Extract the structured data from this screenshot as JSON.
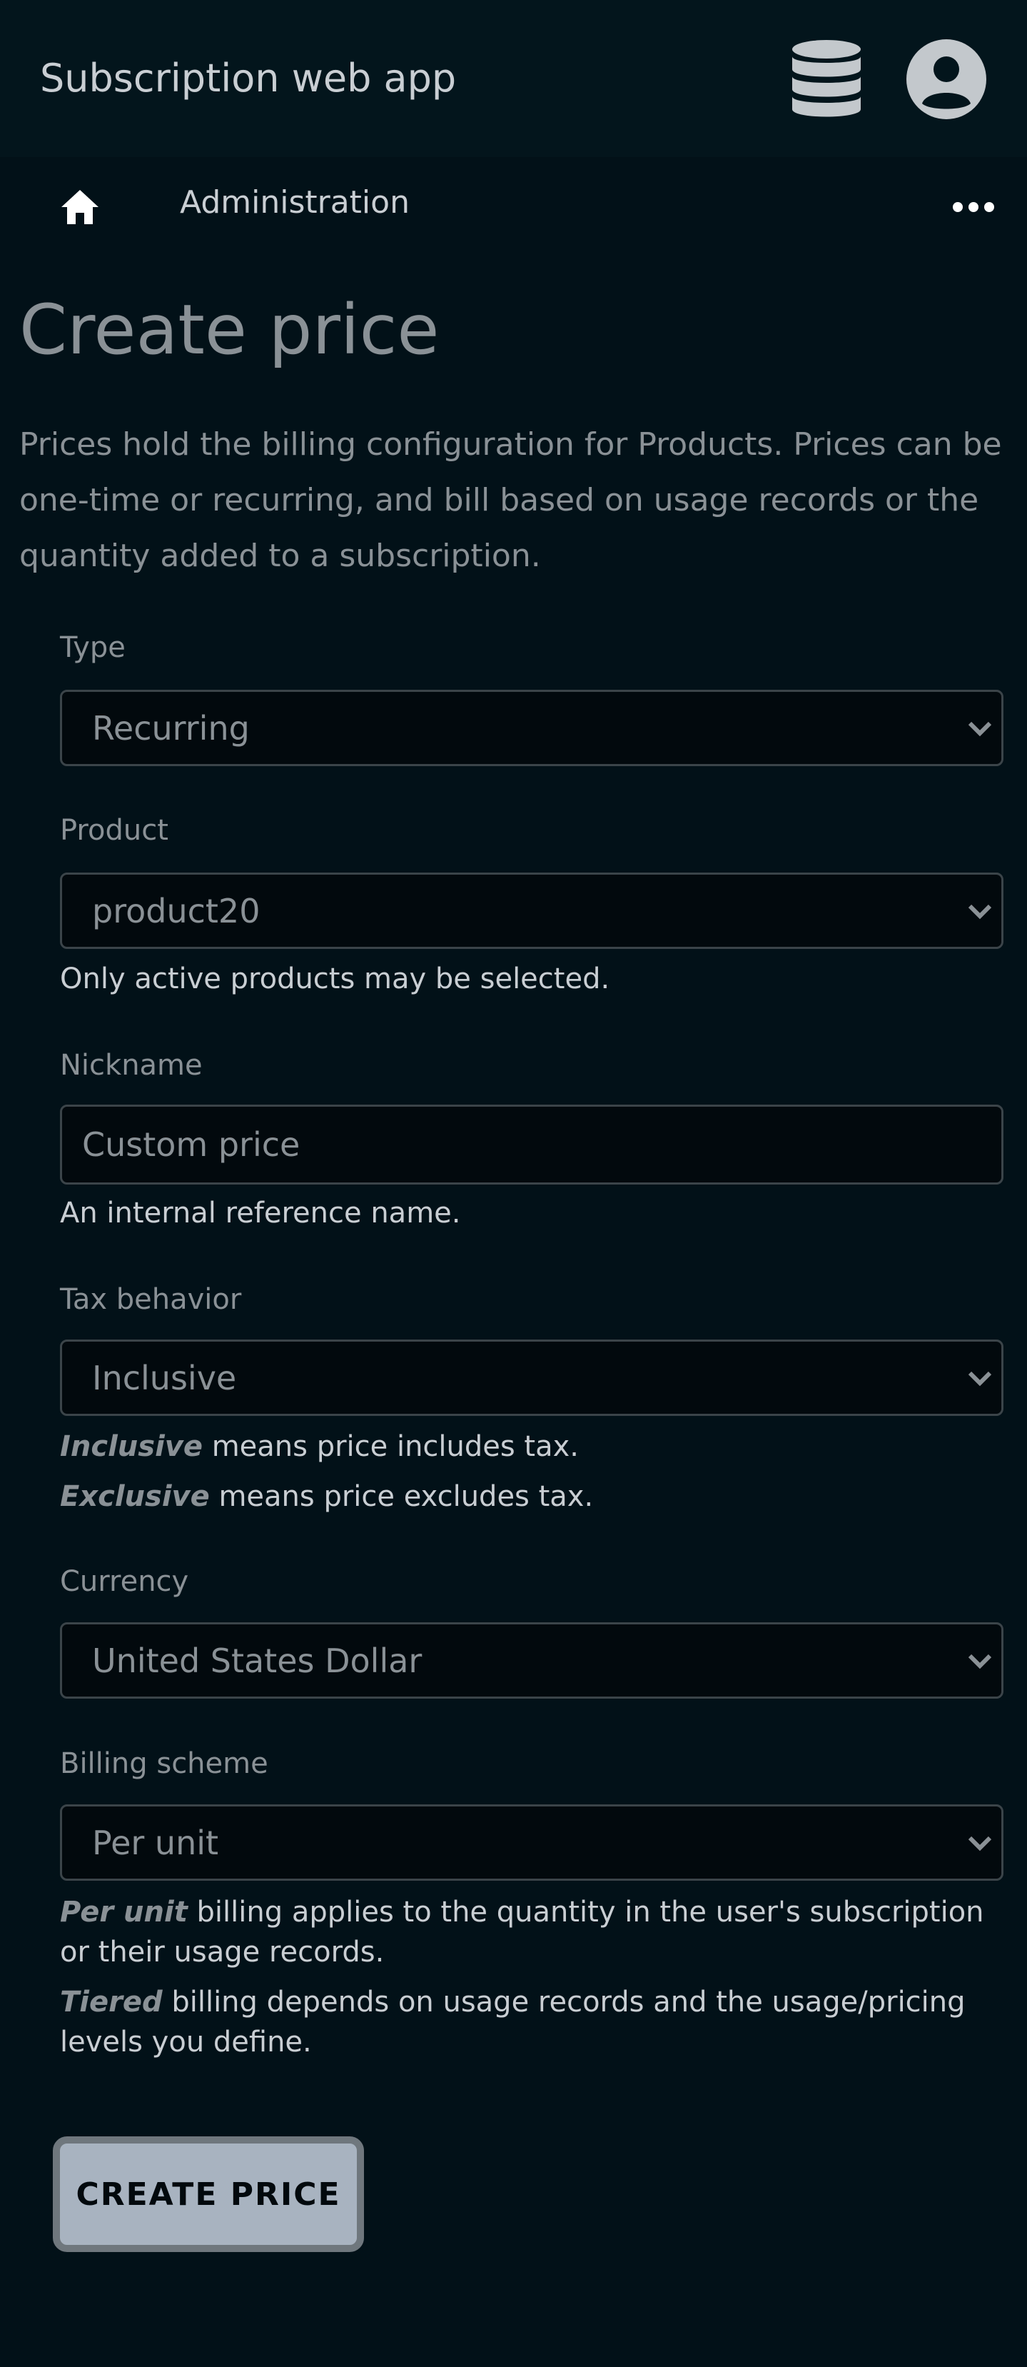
{
  "header": {
    "app_title": "Subscription web app",
    "icons": [
      "database-icon",
      "account-circle-icon"
    ]
  },
  "nav": {
    "home_icon": "home-icon",
    "section": "Administration",
    "more_icon": "more-horizontal-icon"
  },
  "page": {
    "title": "Create price",
    "description": "Prices hold the billing configuration for Products. Prices can be one-time or recurring, and bill based on usage records or the quantity added to a subscription."
  },
  "form": {
    "type": {
      "label": "Type",
      "value": "Recurring"
    },
    "product": {
      "label": "Product",
      "value": "product20",
      "help": "Only active products may be selected."
    },
    "nickname": {
      "label": "Nickname",
      "value": "",
      "placeholder": "Custom price",
      "help": "An internal reference name."
    },
    "tax_behavior": {
      "label": "Tax behavior",
      "value": "Inclusive",
      "help_inclusive_term": "Inclusive",
      "help_inclusive_text": " means price includes tax.",
      "help_exclusive_term": "Exclusive",
      "help_exclusive_text": " means price excludes tax."
    },
    "currency": {
      "label": "Currency",
      "value": "United States Dollar"
    },
    "billing_scheme": {
      "label": "Billing scheme",
      "value": "Per unit",
      "help_per_unit_term": "Per unit",
      "help_per_unit_text": " billing applies to the quantity in the user's subscription or their usage records.",
      "help_tiered_term": "Tiered",
      "help_tiered_text": " billing depends on usage records and the usage/pricing levels you define."
    },
    "submit_label": "CREATE PRICE"
  },
  "colors": {
    "background": "#021118",
    "header_background": "#03151c",
    "muted_text": "#8a9196",
    "text": "#c9ced3",
    "field_background": "#02090d",
    "field_border": "#3b4449",
    "button_background": "#a8b3c0",
    "button_border": "#6f777d"
  }
}
